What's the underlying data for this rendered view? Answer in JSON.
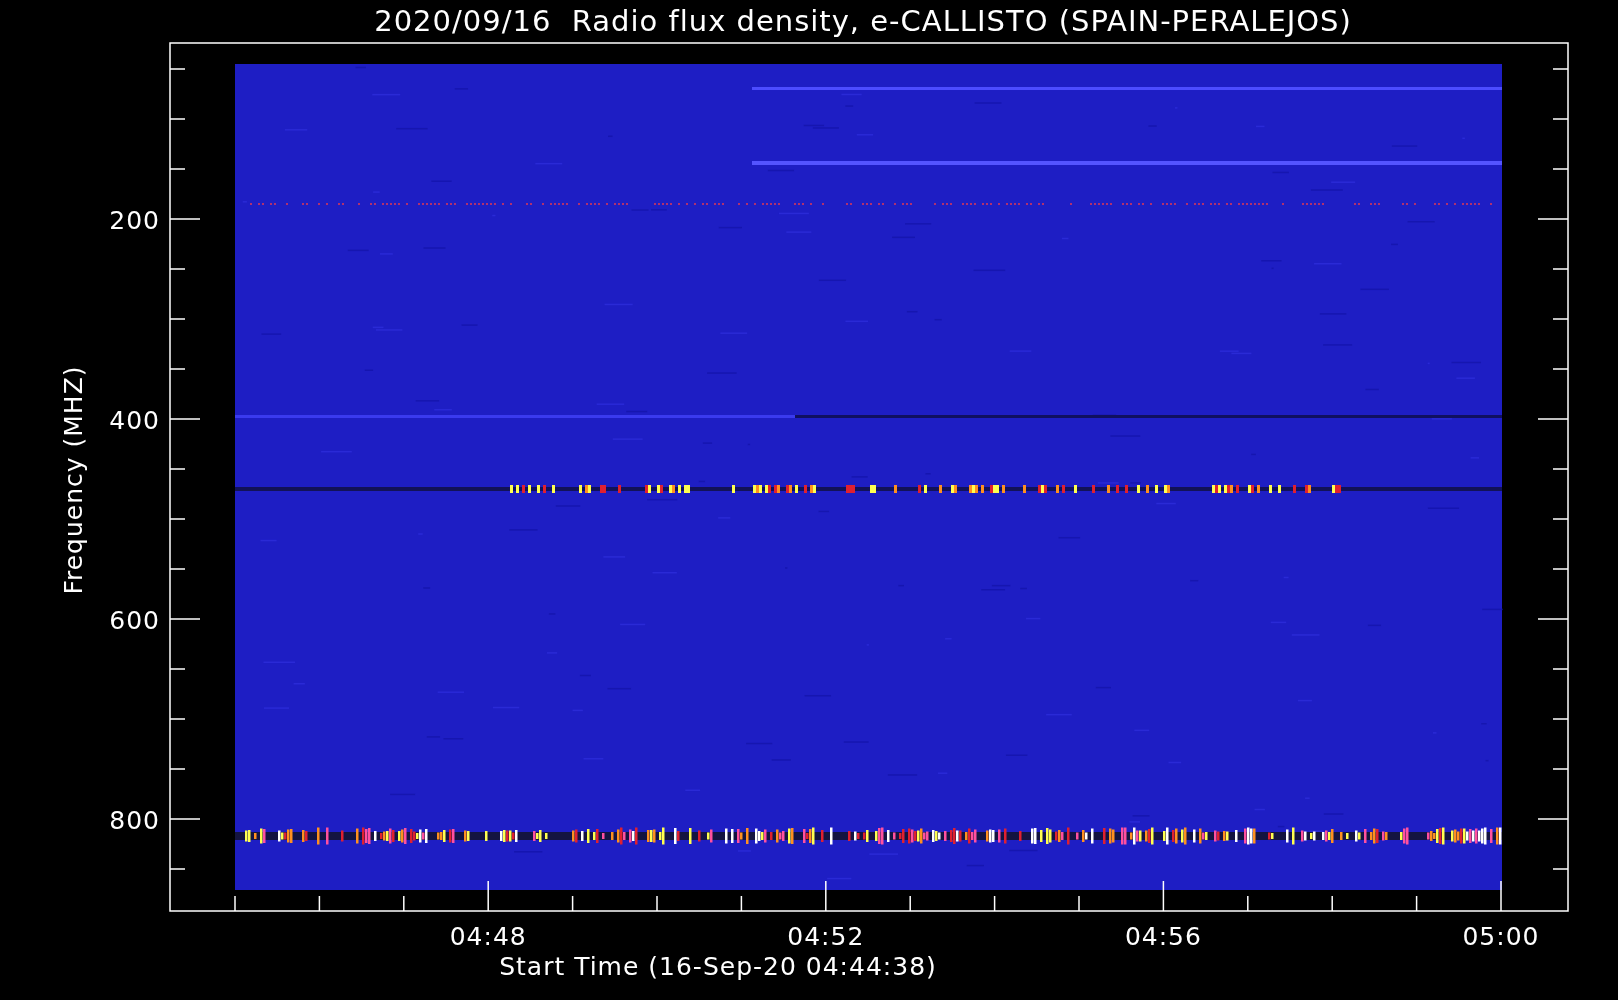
{
  "title": "2020/09/16  Radio flux density, e-CALLISTO (SPAIN-PERALEJOS)",
  "ylabel": "Frequency (MHZ)",
  "xlabel": "Start Time (16-Sep-20 04:44:38)",
  "yticks": [
    "200",
    "400",
    "600",
    "800"
  ],
  "xticks": [
    "04:48",
    "04:52",
    "04:56",
    "05:00"
  ]
}
